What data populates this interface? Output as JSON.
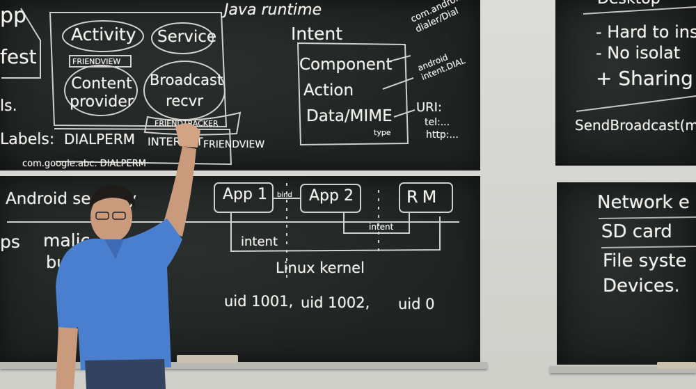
{
  "board_top_left": {
    "app": "pp",
    "manifest": "fest",
    "labels": "ls.",
    "labels2": "Labels:",
    "java_runtime": "Java runtime",
    "activity": "Activity",
    "service": "Service",
    "friendview": "FRIENDVIEW",
    "content_provider": "Content provider",
    "broadcast_receiver": "Broadcast recvr",
    "friendtracker": "FRIENDTRACKER",
    "dialperm": "DIALPERM",
    "internet": "INTERNET",
    "friendview2": "FRIENDVIEW",
    "com_google": "com.google.abc. DIALPERM"
  },
  "board_intent": {
    "intent": "Intent",
    "component": "Component",
    "action": "Action",
    "data_mime": "Data/MIME",
    "type": "type",
    "com_android": "com.android dialer/Dial",
    "android_intent": "android intent.DIAL",
    "uri": "URI:",
    "tel": "tel:...",
    "http": "http:..."
  },
  "board_bottom_left": {
    "android_security": "Android security",
    "apps": "ps",
    "malicious": "malic",
    "bu": "bu",
    "app1": "App 1",
    "bind": "bind",
    "app2": "App 2",
    "rm": "RM",
    "intent_left": "intent",
    "intent_right": "intent",
    "linux_kernel": "Linux kernel",
    "uid1": "uid 1001,",
    "uid2": "uid 1002,",
    "uid0": "uid 0"
  },
  "board_right_top": {
    "desktop": "Desktop",
    "hard": "- Hard to ins",
    "no_isolation": "- No isolat",
    "sharing": "+ Sharing",
    "send_broadcast": "SendBroadcast(m"
  },
  "board_right_bottom": {
    "network": "Network e",
    "sd_card": "SD card",
    "file_system": "File syste",
    "devices": "Devices."
  },
  "colors": {
    "board": "#1f2322",
    "chalk": "#f2f2ec",
    "shirt": "#4a7fd0",
    "wall": "#d9d9d6"
  }
}
